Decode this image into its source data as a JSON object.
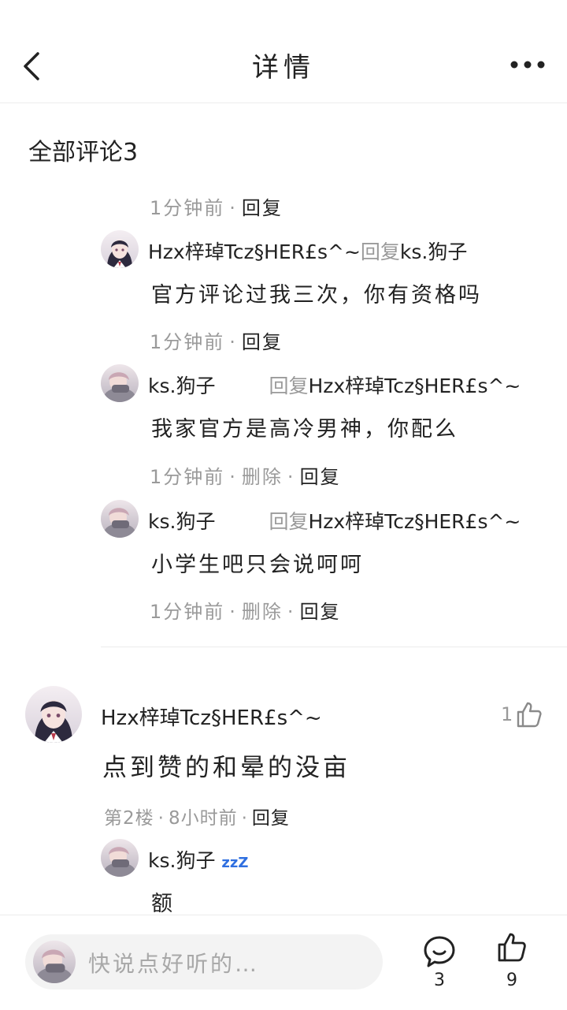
{
  "header": {
    "title": "详情"
  },
  "section_title": "全部评论3",
  "replies": [
    {
      "meta": {
        "time": "1分钟前",
        "delete": "",
        "reply": "回复"
      }
    },
    {
      "author": "Hzx梓琸Tcz§HER£s^~",
      "reply_word": "回复",
      "target": "ks.狗子",
      "text": "官方评论过我三次，你有资格吗",
      "meta": {
        "time": "1分钟前",
        "delete": "",
        "reply": "回复"
      }
    },
    {
      "author": "ks.狗子",
      "reply_word": "回复",
      "target": "Hzx梓琸Tcz§HER£s^~",
      "text": "我家官方是高冷男神，你配么",
      "meta": {
        "time": "1分钟前",
        "delete": "删除",
        "reply": "回复"
      }
    },
    {
      "author": "ks.狗子",
      "reply_word": "回复",
      "target": "Hzx梓琸Tcz§HER£s^~",
      "text": "小学生吧只会说呵呵",
      "meta": {
        "time": "1分钟前",
        "delete": "删除",
        "reply": "回复"
      }
    }
  ],
  "main_comment": {
    "author": "Hzx梓琸Tcz§HER£s^~",
    "likes": "1",
    "text": "点到赞的和晕的没亩",
    "floor": "第2楼",
    "time": "8小时前",
    "reply": "回复",
    "sub_reply": {
      "author": "ks.狗子",
      "badge": "zzZ",
      "text": "额"
    }
  },
  "bottom_bar": {
    "placeholder": "快说点好听的…",
    "comment_count": "3",
    "like_count": "9"
  },
  "icons": {
    "back": "back-arrow-icon",
    "more": "more-dots-icon",
    "like": "thumbs-up-icon",
    "comment": "comment-bubble-icon"
  }
}
